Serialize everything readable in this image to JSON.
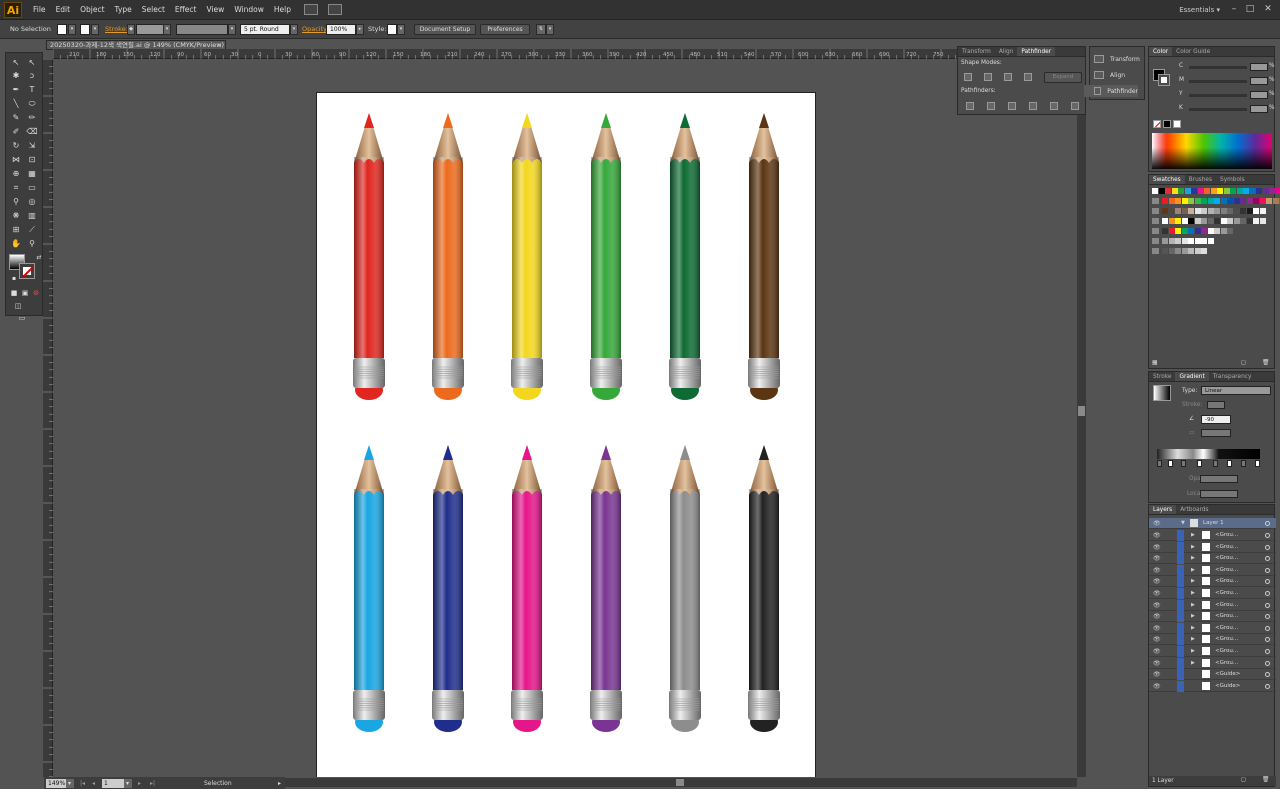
{
  "app": {
    "logo": "Ai",
    "workspace": "Essentials"
  },
  "menu": [
    "File",
    "Edit",
    "Object",
    "Type",
    "Select",
    "Effect",
    "View",
    "Window",
    "Help"
  ],
  "control": {
    "selection": "No Selection",
    "stroke_label": "Stroke:",
    "brush": "5 pt. Round",
    "opacity_label": "Opacity:",
    "opacity_value": "100%",
    "style_label": "Style:",
    "doc_setup": "Document Setup",
    "preferences": "Preferences"
  },
  "document": {
    "tab": "20250320-과제-12색 색연필.ai @ 149% (CMYK/Preview)",
    "close": "×"
  },
  "ruler_ticks": [
    "210",
    "180",
    "150",
    "120",
    "90",
    "60",
    "30",
    "0",
    "30",
    "60",
    "90",
    "120",
    "150",
    "180",
    "210",
    "240",
    "270",
    "300",
    "330",
    "360",
    "390",
    "420",
    "450",
    "480",
    "510",
    "540",
    "570",
    "600",
    "630",
    "660",
    "690",
    "720",
    "750",
    "780",
    "810",
    "840",
    "870",
    "900"
  ],
  "status": {
    "zoom": "149%",
    "page": "1",
    "tool": "Selection"
  },
  "pathfinder": {
    "tabs": [
      "Transform",
      "Align",
      "Pathfinder"
    ],
    "active": 2,
    "shape_modes": "Shape Modes:",
    "expand": "Expand",
    "pathfinders": "Pathfinders:"
  },
  "mini_panels": [
    "Transform",
    "Align",
    "Pathfinder"
  ],
  "color_panel": {
    "tabs": [
      "Color",
      "Color Guide"
    ],
    "channels": [
      "C",
      "M",
      "Y",
      "K"
    ],
    "pct": "%"
  },
  "swatches_panel": {
    "tabs": [
      "Swatches",
      "Brushes",
      "Symbols"
    ]
  },
  "gradient_panel": {
    "tabs": [
      "Stroke",
      "Gradient",
      "Transparency"
    ],
    "type_label": "Type:",
    "type_value": "Linear",
    "stroke_label": "Stroke:",
    "angle_value": "-90",
    "opacity_label": "Opacity:",
    "location_label": "Location:"
  },
  "layers_panel": {
    "tabs": [
      "Layers",
      "Artboards"
    ],
    "layer": "Layer 1",
    "groups": [
      "<Grou...",
      "<Grou...",
      "<Grou...",
      "<Grou...",
      "<Grou...",
      "<Grou...",
      "<Grou...",
      "<Grou...",
      "<Grou...",
      "<Grou...",
      "<Grou...",
      "<Grou...",
      "<Guide>",
      "<Guide>"
    ],
    "footer": "1 Layer"
  },
  "pencils": {
    "row1": [
      "#e0261f",
      "#ec6a1e",
      "#f3d71f",
      "#36a83a",
      "#0e6b33",
      "#5c3512"
    ],
    "row2": [
      "#19a6e2",
      "#1f2e8c",
      "#e5158a",
      "#7a3593",
      "#8d8d8d",
      "#222222"
    ]
  },
  "swatch_colors": [
    [
      "#ffffff",
      "#000000",
      "#e23030",
      "#f7e21c",
      "#2a9d3b",
      "#1aa3dd",
      "#2d3592",
      "#e3178a",
      "#f1632a",
      "#f8a11b",
      "#fff200",
      "#8dc63f",
      "#00a651",
      "#00a99d",
      "#00aeef",
      "#0072bc",
      "#2e3192",
      "#662d91",
      "#92278f",
      "#ec008c"
    ],
    [
      "#ed1c24",
      "#f26522",
      "#f7941d",
      "#fff200",
      "#8dc63f",
      "#39b54a",
      "#00a651",
      "#00a99d",
      "#00aeef",
      "#0072bc",
      "#0054a6",
      "#2e3192",
      "#662d91",
      "#92278f",
      "#9e005d",
      "#ed145b",
      "#c69c6d",
      "#a67c52",
      "#8c6239",
      "#754c24"
    ],
    [
      "#603913",
      "#534741",
      "#998675",
      "#736357",
      "#c7b299",
      "#e6e6e6",
      "#cccccc",
      "#b3b3b3",
      "#999999",
      "#808080",
      "#666666",
      "#4d4d4d",
      "#333333",
      "#1a1a1a",
      "#ffffff",
      "#f2f2f2"
    ],
    [
      "#ffffff",
      "#f7941d",
      "#fff200",
      "#ffffff",
      "#000000",
      "#cccccc",
      "#999999",
      "#666666",
      "#333333",
      "#ffffff",
      "#cccccc",
      "#999999",
      "#666666",
      "#333333",
      "#f2f2f2",
      "#e6e6e6"
    ],
    [
      "#333333",
      "#ed1c24",
      "#fff200",
      "#00a651",
      "#0072bc",
      "#2e3192",
      "#92278f",
      "#ffffff",
      "#cccccc",
      "#999999",
      "#666666"
    ],
    [
      "#999999",
      "#b3b3b3",
      "#cccccc",
      "#e6e6e6",
      "#ffffff",
      "#ffffff",
      "#ffffff",
      "#ffffff"
    ],
    [
      "#555555",
      "#666666",
      "#888888",
      "#999999",
      "#bbbbbb",
      "#cccccc",
      "#dddddd"
    ]
  ]
}
